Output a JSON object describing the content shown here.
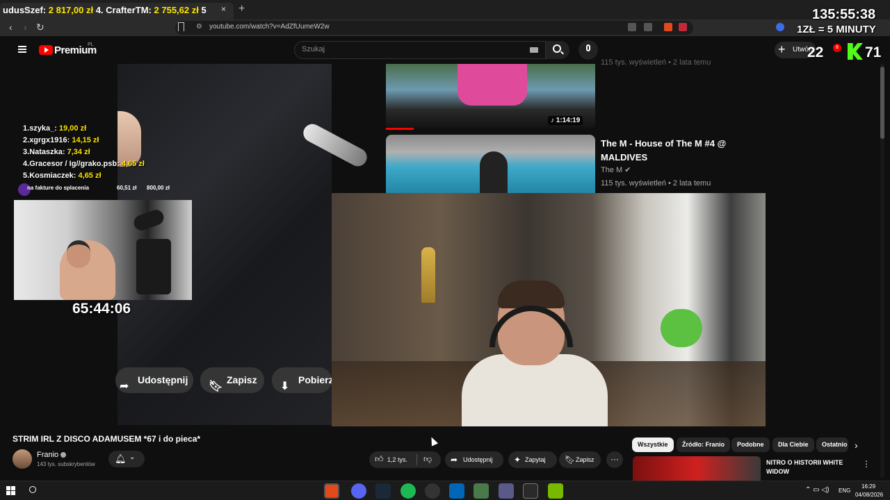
{
  "browser": {
    "tab_title_prefix": "udusSzef:",
    "tab_title_amount1": "2 817,00 zł",
    "tab_title_mid": "4. CrafterTM:",
    "tab_title_amount2": "2 755,62 zł",
    "tab_title_suffix": "5",
    "close_tab": "×",
    "new_tab": "+",
    "url": "youtube.com/watch?v=AdZfUumeW2w"
  },
  "youtube": {
    "premium_label": "Premium",
    "country_code": "PL",
    "search_placeholder": "Szukaj",
    "create_label": "Utwórz"
  },
  "overlay": {
    "timer_big": "135:55:38",
    "price_per_minute": "1ZŁ = 5 MINUTY",
    "subs_count": "22",
    "notif_count": "8",
    "viewers": "71",
    "timer_small": "65:44:06",
    "donations": [
      {
        "rank": "1.",
        "name": "szyka_:",
        "amount": "19,00 zł"
      },
      {
        "rank": "2.",
        "name": "xgrgx1916:",
        "amount": "14,15 zł"
      },
      {
        "rank": "3.",
        "name": "Nataszka:",
        "amount": "7,34 zł"
      },
      {
        "rank": "4.",
        "name": "Gracesor / Ig//grako.psb:",
        "amount": "4,65 zł"
      },
      {
        "rank": "5.",
        "name": "Kosmiaczek:",
        "amount": "4,65 zł"
      }
    ],
    "goal": {
      "label": "na fakture do splacenia",
      "current": "60,51 zł",
      "target": "800,00 zł"
    }
  },
  "player": {
    "share_label": "Udostępnij",
    "save_label": "Zapisz",
    "download_label": "Pobierz"
  },
  "related_top": [
    {
      "duration": "1:14:19",
      "meta": "115 tys. wyświetleń • 2 lata temu"
    },
    {
      "title": "The M - House of The M #4 @ MALDIVES",
      "channel": "The M",
      "meta": "115 tys. wyświetleń • 2 lata temu"
    }
  ],
  "video": {
    "title": "STRIM IRL Z DISCO ADAMUSEM *67 i do pieca*",
    "channel": "Franio",
    "subscribers": "143 tys. subskrybentów",
    "likes": "1,2 tys.",
    "share": "Udostępnij",
    "ask": "Zapytaj",
    "save": "Zapisz",
    "more": "···"
  },
  "chips": [
    "Wszystkie",
    "Źródło: Franio",
    "Podobne",
    "Dla Ciebie",
    "Ostatnio"
  ],
  "related_bottom": {
    "title": "NITRO O HISTORII WHITE WIDOW"
  },
  "taskbar": {
    "lang": "ENG",
    "time": "16:29",
    "date": "04/08/2026"
  },
  "colors": {
    "yt_red": "#ff0000",
    "donation_yellow": "#ffe600",
    "kick_green": "#53fc18"
  }
}
